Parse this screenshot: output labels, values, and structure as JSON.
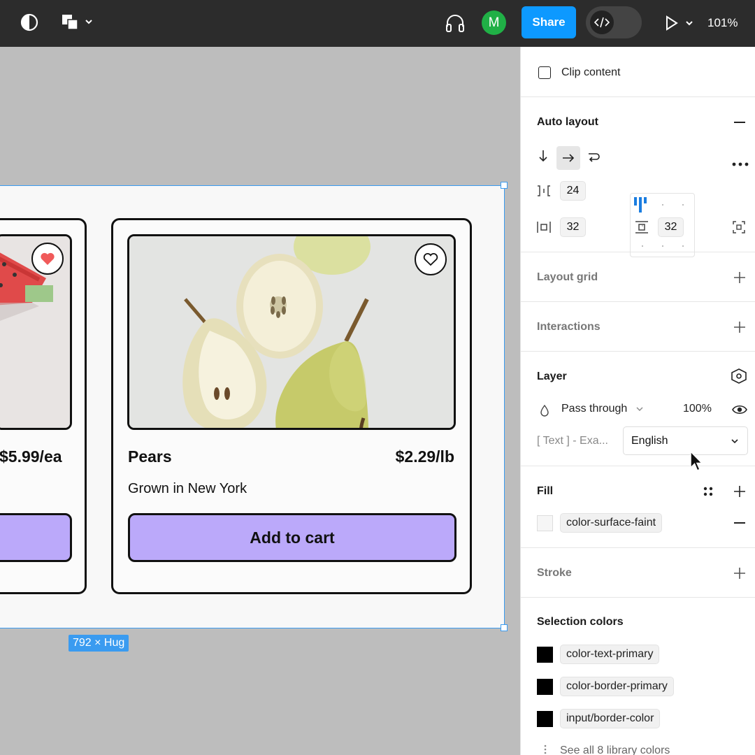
{
  "toolbar": {
    "avatar_initial": "M",
    "share_label": "Share",
    "zoom": "101%"
  },
  "canvas": {
    "frame_size_label": "792 × Hug",
    "cards": [
      {
        "price": "$5.99/ea",
        "favorited": true
      },
      {
        "name": "Pears",
        "price": "$2.29/lb",
        "description": "Grown in New York",
        "button_label": "Add to cart",
        "favorited": false
      }
    ]
  },
  "panel": {
    "clip_content_label": "Clip content",
    "auto_layout": {
      "title": "Auto layout",
      "gap": "24",
      "padding_horizontal": "32",
      "padding_vertical": "32"
    },
    "layout_grid_title": "Layout grid",
    "interactions_title": "Interactions",
    "layer": {
      "title": "Layer",
      "blend_mode": "Pass through",
      "opacity": "100%",
      "text_label": "[ Text ] - Exa...",
      "language": "English"
    },
    "fill": {
      "title": "Fill",
      "swatch_name": "color-surface-faint",
      "swatch_color": "#f6f6f6"
    },
    "stroke_title": "Stroke",
    "selection_colors": {
      "title": "Selection colors",
      "items": [
        {
          "name": "color-text-primary",
          "color": "#000000"
        },
        {
          "name": "color-border-primary",
          "color": "#000000"
        },
        {
          "name": "input/border-color",
          "color": "#000000"
        }
      ],
      "see_all": "See all 8 library colors"
    }
  },
  "colors": {
    "toolbar_bg": "#2c2c2c",
    "share_blue": "#0d99ff",
    "avatar_green": "#20b046",
    "button_purple": "#bba9fa",
    "selection_blue": "#3a9bf0"
  }
}
